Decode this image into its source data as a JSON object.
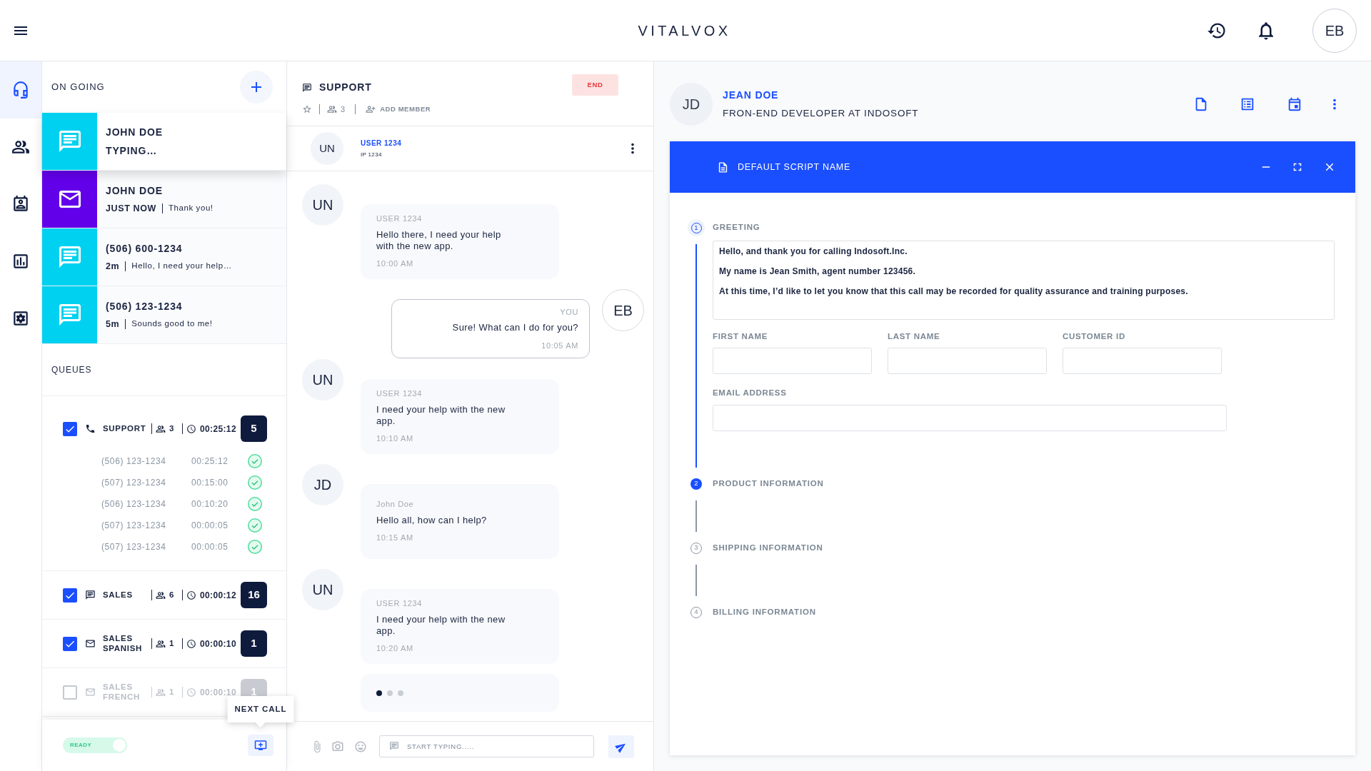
{
  "app_bar": {
    "title": "VITALVOX",
    "avatar": "EB"
  },
  "nav_rail": [
    {
      "selected": true
    },
    {
      "selected": false
    },
    {
      "selected": false
    },
    {
      "selected": false
    },
    {
      "selected": false
    }
  ],
  "ongoing": {
    "title": "ON GOING",
    "items": [
      {
        "kind": "chat",
        "color": "#00d1f0",
        "selected": true,
        "name": "JOHN DOE",
        "status": "TYPING…"
      },
      {
        "kind": "email",
        "color": "#6200ea",
        "selected": false,
        "name": "JOHN DOE",
        "time": "JUST NOW",
        "preview": "Thank you!"
      },
      {
        "kind": "chat",
        "color": "#00d1f0",
        "selected": false,
        "name": "(506) 600-1234",
        "time": "2m",
        "preview": "Hello, I need your help…"
      },
      {
        "kind": "chat",
        "color": "#00d1f0",
        "selected": false,
        "name": "(506) 123-1234",
        "time": "5m",
        "preview": "Sounds good to me!"
      }
    ]
  },
  "queues": {
    "title": "QUEUES",
    "items": [
      {
        "kind": "phone",
        "checked": true,
        "name": "SUPPORT",
        "members": "3",
        "wait": "00:25:12",
        "count": "5",
        "calls": [
          {
            "number": "(506) 123-1234",
            "duration": "00:25:12"
          },
          {
            "number": "(507) 123-1234",
            "duration": "00:15:00"
          },
          {
            "number": "(506) 123-1234",
            "duration": "00:10:20"
          },
          {
            "number": "(507) 123-1234",
            "duration": "00:00:05"
          },
          {
            "number": "(507) 123-1234",
            "duration": "00:00:05"
          }
        ]
      },
      {
        "kind": "chat",
        "checked": true,
        "name": "SALES",
        "members": "6",
        "wait": "00:00:12",
        "count": "16"
      },
      {
        "kind": "email",
        "checked": true,
        "name": "SALES SPANISH",
        "members": "1",
        "wait": "00:00:10",
        "count": "1"
      },
      {
        "kind": "email",
        "checked": false,
        "name": "SALES FRENCH",
        "members": "1",
        "wait": "00:00:10",
        "count": "1"
      }
    ]
  },
  "status_toggle": {
    "label": "READY",
    "on": true
  },
  "next_call": {
    "tooltip": "NEXT CALL"
  },
  "chat": {
    "title": "SUPPORT",
    "favorite": false,
    "members": "3",
    "add_member": "ADD MEMBER",
    "end_button": "END",
    "participant": {
      "initials": "UN",
      "name": "USER 1234",
      "ip": "IP 1234"
    },
    "messages": [
      {
        "kind": "incoming",
        "initials": "UN",
        "sender": "USER 1234",
        "text": "Hello there, I need your help with the new app.",
        "time": "10:00 AM"
      },
      {
        "kind": "outgoing",
        "initials": "EB",
        "sender": "YOU",
        "text": "Sure! What can I do for you?",
        "time": "10:05 AM"
      },
      {
        "kind": "incoming",
        "initials": "UN",
        "sender": "USER 1234",
        "text": "I need your help with the new app.",
        "time": "10:10 AM"
      },
      {
        "kind": "incoming",
        "initials": "JD",
        "sender": "John Doe",
        "text": "Hello all, how can I help?",
        "time": "10:15 AM"
      },
      {
        "kind": "incoming",
        "initials": "UN",
        "sender": "USER 1234",
        "text": "I need your help with the new app.",
        "time": "10:20 AM"
      }
    ],
    "typing": true,
    "composer": {
      "placeholder": "START TYPING....."
    }
  },
  "contact": {
    "initials": "JD",
    "name": "JEAN DOE",
    "title": "FRON-END DEVELOPER AT INDOSOFT"
  },
  "script": {
    "title": "DEFAULT SCRIPT NAME",
    "steps": [
      {
        "number": "1",
        "label": "GREETING",
        "expanded": true,
        "completed": false,
        "lines": [
          "Hello, and thank you for calling Indosoft.Inc.",
          "My name is Jean Smith, agent number 123456.",
          "At this time, I’d like to let you know that this call may be recorded for quality assurance and training purposes."
        ],
        "fields": [
          {
            "kind": "short",
            "label": "FIRST NAME"
          },
          {
            "kind": "short",
            "label": "LAST NAME"
          },
          {
            "kind": "short",
            "label": "CUSTOMER ID"
          },
          {
            "kind": "wide",
            "label": "EMAIL ADDRESS"
          }
        ]
      },
      {
        "number": "2",
        "label": "PRODUCT INFORMATION",
        "expanded": false,
        "completed": true
      },
      {
        "number": "3",
        "label": "SHIPPING INFORMATION",
        "expanded": false,
        "completed": false
      },
      {
        "number": "4",
        "label": "BILLING INFORMATION",
        "expanded": false,
        "completed": false
      }
    ]
  }
}
